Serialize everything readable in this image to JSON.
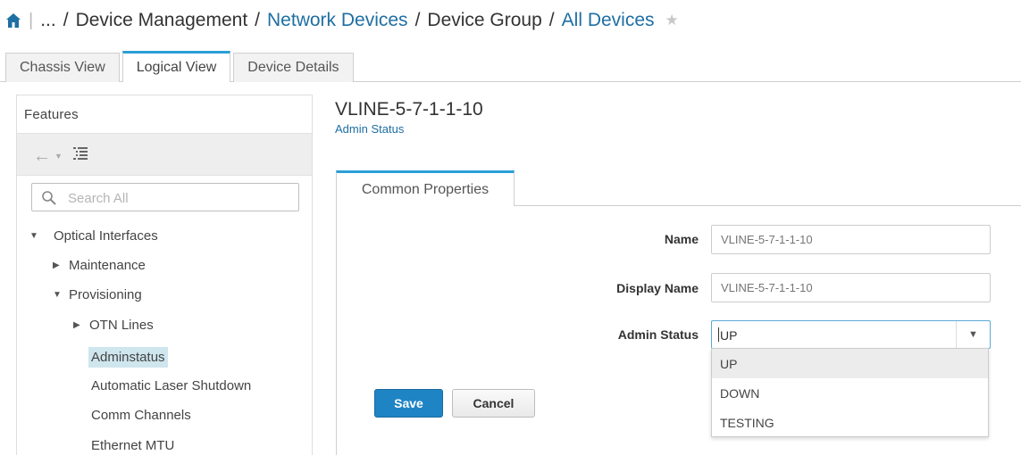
{
  "breadcrumb": {
    "ellipsis": "...",
    "separator": "/",
    "items": [
      {
        "label": "Device Management"
      },
      {
        "label": "Network Devices"
      },
      {
        "label": "Device Group"
      },
      {
        "label": "All Devices"
      }
    ]
  },
  "top_tabs": [
    {
      "label": "Chassis View"
    },
    {
      "label": "Logical View",
      "active": true
    },
    {
      "label": "Device Details"
    }
  ],
  "features": {
    "title": "Features",
    "search_placeholder": "Search All",
    "tree": [
      {
        "label": "Optical Interfaces",
        "toggle": "▼"
      },
      {
        "label": "Maintenance",
        "toggle": "▶"
      },
      {
        "label": "Provisioning",
        "toggle": "▼"
      },
      {
        "label": "OTN Lines",
        "toggle": "▶"
      },
      {
        "label": "Adminstatus",
        "selected": true
      },
      {
        "label": "Automatic Laser Shutdown"
      },
      {
        "label": "Comm Channels"
      },
      {
        "label": "Ethernet MTU"
      }
    ]
  },
  "content": {
    "title": "VLINE-5-7-1-1-10",
    "subtitle": "Admin Status",
    "tab_label": "Common Properties",
    "fields": {
      "name_label": "Name",
      "name_placeholder": "VLINE-5-7-1-1-10",
      "display_name_label": "Display Name",
      "display_name_placeholder": "VLINE-5-7-1-1-10",
      "admin_status_label": "Admin Status",
      "admin_status_value": "UP",
      "admin_status_options": [
        "UP",
        "DOWN",
        "TESTING"
      ]
    },
    "save_label": "Save",
    "cancel_label": "Cancel"
  },
  "colors": {
    "link": "#1e6fa3",
    "accent": "#2b9fd6",
    "primary_button": "#1f84c4",
    "selected_row": "#cfe6ee"
  }
}
